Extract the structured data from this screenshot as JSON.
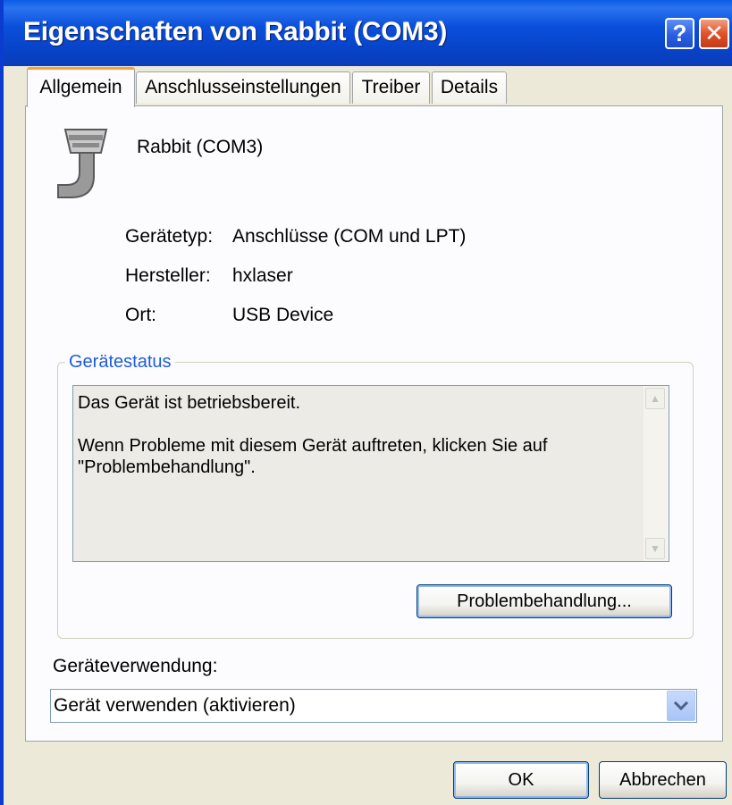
{
  "window": {
    "title": "Eigenschaften von Rabbit (COM3)",
    "help_label": "?",
    "close_label": "✕"
  },
  "tabs": [
    {
      "label": "Allgemein",
      "active": true
    },
    {
      "label": "Anschlusseinstellungen",
      "active": false
    },
    {
      "label": "Treiber",
      "active": false
    },
    {
      "label": "Details",
      "active": false
    }
  ],
  "device": {
    "icon": "serial-port-icon",
    "name": "Rabbit (COM3)"
  },
  "properties": [
    {
      "label": "Gerätetyp:",
      "value": "Anschlüsse (COM und LPT)"
    },
    {
      "label": "Hersteller:",
      "value": "hxlaser"
    },
    {
      "label": "Ort:",
      "value": "USB Device"
    }
  ],
  "status": {
    "group_title": "Gerätestatus",
    "lines": [
      "Das Gerät ist betriebsbereit.",
      "Wenn Probleme mit diesem Gerät auftreten, klicken Sie auf",
      "\"Problembehandlung\"."
    ],
    "troubleshoot_label": "Problembehandlung..."
  },
  "usage": {
    "label": "Geräteverwendung:",
    "selected": "Gerät verwenden (aktivieren)"
  },
  "footer": {
    "ok_label": "OK",
    "cancel_label": "Abbrechen"
  },
  "colors": {
    "titlebar": "#0a4fdc",
    "dialog_bg": "#ece9d8",
    "group_title": "#1d5cd9",
    "tab_highlight": "#f2a23c",
    "close_button": "#e0522a"
  }
}
